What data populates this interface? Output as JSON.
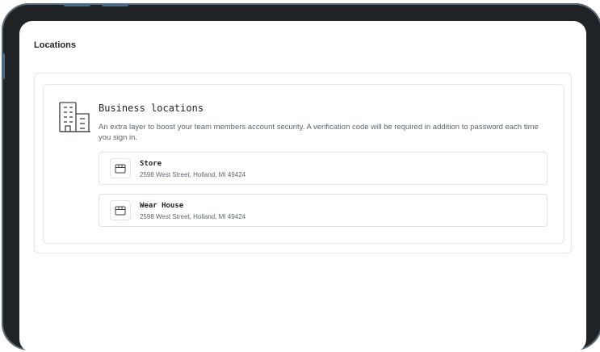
{
  "page": {
    "title": "Locations"
  },
  "business": {
    "icon": "building-icon",
    "title": "Business locations",
    "description": "An extra layer to boost your team members account security. A verification code will be required in addition to password each time you sign in.",
    "locations": [
      {
        "name": "Store",
        "address": "2598 West Street, Holland, MI 49424",
        "icon": "storefront-icon"
      },
      {
        "name": "Wear House",
        "address": "2598 West Street, Holland, MI 49424",
        "icon": "storefront-icon"
      }
    ]
  },
  "colors": {
    "frame": "#1f2326",
    "rim": "#5a6a78",
    "border": "#e3e6ea",
    "text": "#1e2328",
    "muted": "#5d6570"
  }
}
